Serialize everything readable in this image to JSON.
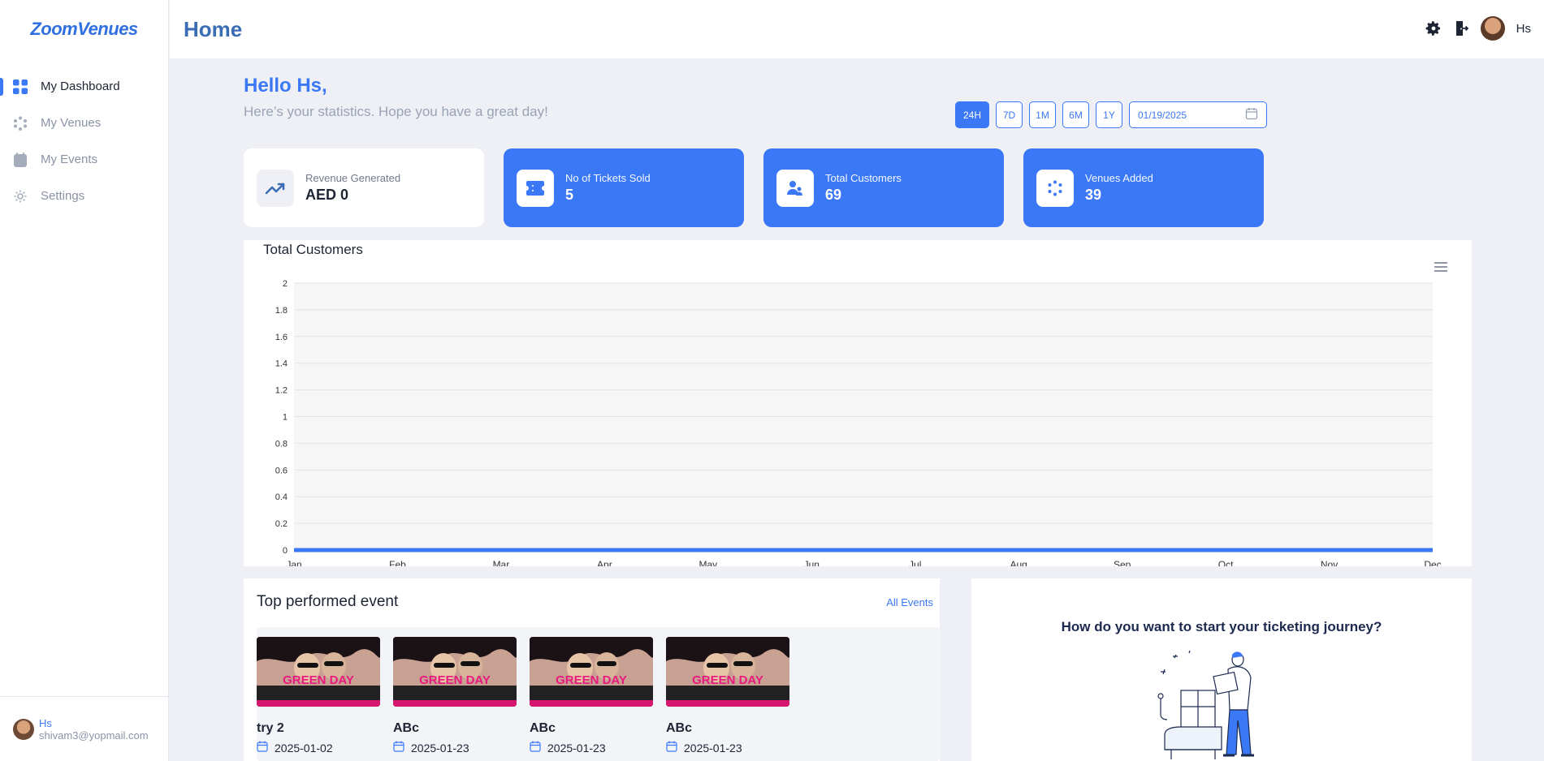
{
  "app": {
    "logo_text_a": "Zoom",
    "logo_text_b": "Venues"
  },
  "sidebar": {
    "items": [
      {
        "label": "My Dashboard",
        "icon": "grid-icon",
        "active": true
      },
      {
        "label": "My Venues",
        "icon": "dots-icon",
        "active": false
      },
      {
        "label": "My Events",
        "icon": "calendar-icon",
        "active": false
      },
      {
        "label": "Settings",
        "icon": "gear-icon",
        "active": false
      }
    ],
    "user": {
      "name": "Hs",
      "email": "shivam3@yopmail.com"
    }
  },
  "header": {
    "title": "Home",
    "user_name": "Hs"
  },
  "greeting": {
    "title": "Hello Hs,",
    "subtitle": "Here’s your statistics. Hope you have a great day!"
  },
  "range": {
    "buttons": [
      "24H",
      "7D",
      "1M",
      "6M",
      "1Y"
    ],
    "selected": "24H",
    "date": "01/19/2025"
  },
  "stats": [
    {
      "label": "Revenue Generated",
      "value": "AED 0",
      "icon": "trend-up-icon"
    },
    {
      "label": "No of Tickets Sold",
      "value": "5",
      "icon": "ticket-icon"
    },
    {
      "label": "Total Customers",
      "value": "69",
      "icon": "users-icon"
    },
    {
      "label": "Venues Added",
      "value": "39",
      "icon": "dots-icon"
    }
  ],
  "chart_data": {
    "type": "area",
    "title": "Total Customers",
    "categories": [
      "Jan",
      "Feb",
      "Mar",
      "Apr",
      "May",
      "Jun",
      "Jul",
      "Aug",
      "Sep",
      "Oct",
      "Nov",
      "Dec"
    ],
    "series": [
      {
        "values": [
          0,
          0,
          0,
          0,
          0,
          0,
          0,
          0,
          0,
          0,
          0,
          0
        ]
      }
    ],
    "yticks": [
      "0",
      "0.2",
      "0.4",
      "0.6",
      "0.8",
      "1",
      "1.2",
      "1.4",
      "1.6",
      "1.8",
      "2"
    ],
    "ylim": [
      0,
      2
    ],
    "grid": true,
    "color": "#3b78f5"
  },
  "events": {
    "title": "Top performed event",
    "all_label": "All Events",
    "poster_text": "GREEN DAY",
    "items": [
      {
        "name": "try 2",
        "date": "2025-01-02"
      },
      {
        "name": "ABc",
        "date": "2025-01-23"
      },
      {
        "name": "ABc",
        "date": "2025-01-23"
      },
      {
        "name": "ABc",
        "date": "2025-01-23"
      }
    ]
  },
  "journey": {
    "title": "How do you want to start your ticketing journey?"
  },
  "colors": {
    "primary": "#3b78f5",
    "background": "#eef0f5"
  }
}
